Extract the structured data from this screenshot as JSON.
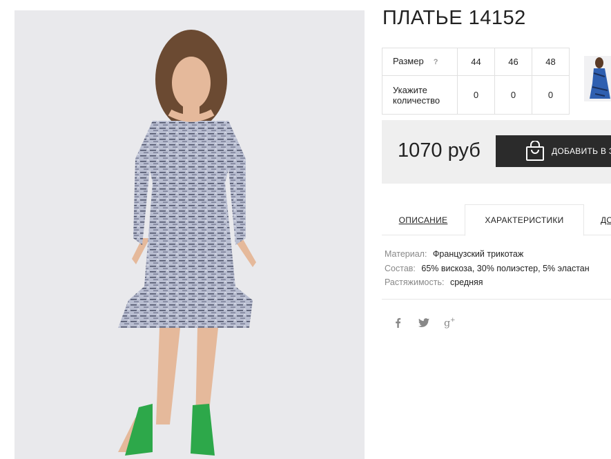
{
  "product": {
    "title": "ПЛАТЬЕ 14152",
    "image_alt": "dress-photo"
  },
  "size_table": {
    "size_label": "Размер",
    "help_mark": "?",
    "sizes": [
      "44",
      "46",
      "48"
    ],
    "qty_label": "Укажите количество",
    "quantities": [
      "0",
      "0",
      "0"
    ]
  },
  "buy": {
    "price": "1070 руб",
    "cart_label": "ДОБАВИТЬ В КОРЗИНУ",
    "cart_visible_label": "ДОБАВИТЬ В З"
  },
  "tabs": [
    {
      "label": "ОПИСАНИЕ"
    },
    {
      "label": "ХАРАКТЕРИСТИКИ",
      "active": true
    },
    {
      "label": "ДО"
    }
  ],
  "specs": [
    {
      "key": "Материал:",
      "value": "Французский трикотаж"
    },
    {
      "key": "Состав:",
      "value": "65% вискоза, 30% полиэстер, 5% эластан"
    },
    {
      "key": "Растяжимость:",
      "value": "средняя"
    }
  ],
  "social": [
    "facebook-icon",
    "twitter-icon",
    "google-plus-icon"
  ],
  "colors": {
    "button_bg": "#2b2b2b",
    "buy_box_bg": "#efefef",
    "photo_bg": "#e9e9ec",
    "dress": "#a9aec4"
  }
}
